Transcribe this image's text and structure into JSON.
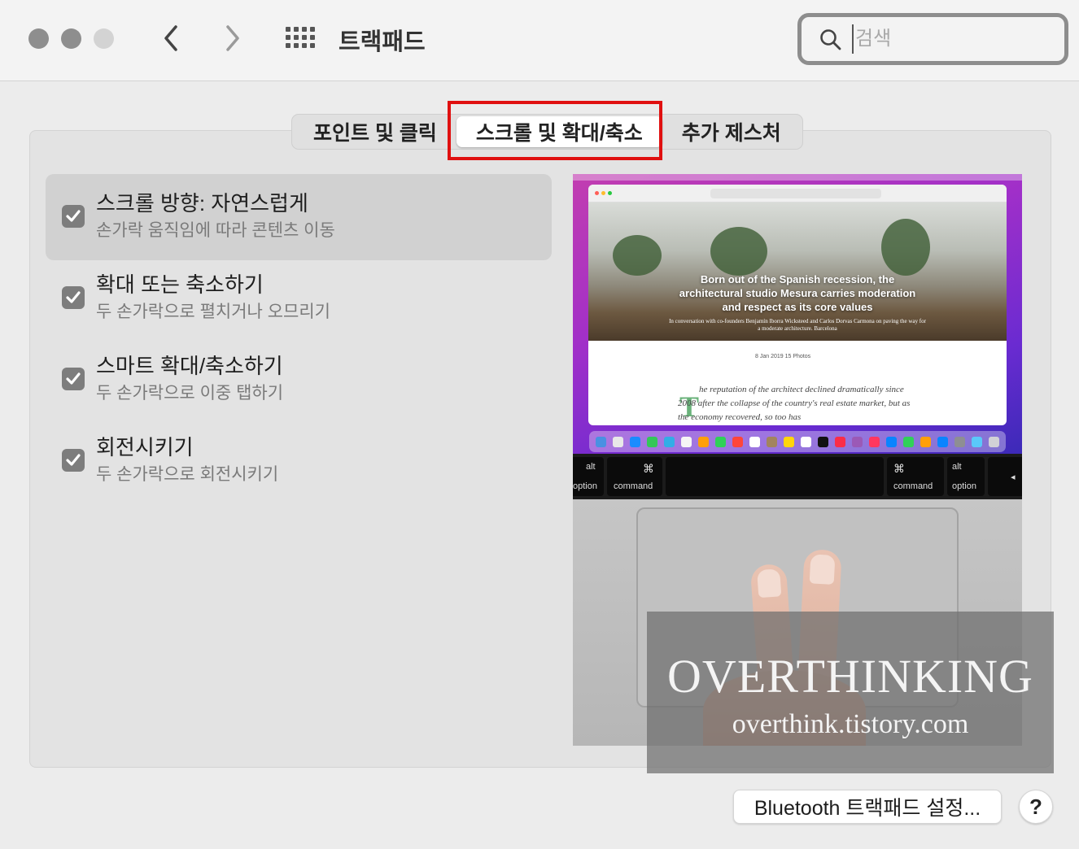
{
  "window": {
    "title": "트랙패드",
    "search": {
      "placeholder": "검색",
      "value": ""
    }
  },
  "tabs": [
    {
      "label": "포인트 및 클릭",
      "selected": false
    },
    {
      "label": "스크롤 및 확대/축소",
      "selected": true
    },
    {
      "label": "추가 제스처",
      "selected": false
    }
  ],
  "options": [
    {
      "title": "스크롤 방향: 자연스럽게",
      "subtitle": "손가락 움직임에 따라 콘텐츠 이동",
      "checked": true,
      "highlighted": true
    },
    {
      "title": "확대 또는 축소하기",
      "subtitle": "두 손가락으로 펼치거나 오므리기",
      "checked": true,
      "highlighted": false
    },
    {
      "title": "스마트 확대/축소하기",
      "subtitle": "두 손가락으로 이중 탭하기",
      "checked": true,
      "highlighted": false
    },
    {
      "title": "회전시키기",
      "subtitle": "두 손가락으로 회전시키기",
      "checked": true,
      "highlighted": false
    }
  ],
  "preview": {
    "headline": [
      "Born out of the Spanish recession, the",
      "architectural studio Mesura carries moderation",
      "and respect as its core values"
    ],
    "caption": [
      "In conversation with co-founders Benjamín Iborra Wicksteed and Carlos Dorvas Carmona on paving the way for",
      "a moderate architecture. Barcelona"
    ],
    "meta": "8 Jan 2019     15 Photos",
    "drop_cap": "T",
    "body": "he reputation of the architect declined dramatically since 2008 after the collapse of the country's real estate market, but as the economy recovered, so too has",
    "keys": {
      "left_alt": "alt",
      "left_option": "option",
      "left_cmd_symbol": "⌘",
      "left_command": "command",
      "right_cmd_symbol": "⌘",
      "right_command": "command",
      "right_alt": "alt",
      "right_option": "option"
    }
  },
  "watermark": {
    "title": "OVERTHINKING",
    "url": "overthink.tistory.com"
  },
  "buttons": {
    "bluetooth": "Bluetooth 트랙패드 설정...",
    "help": "?"
  },
  "colors": {
    "highlight_box": "#e01010",
    "checkbox": "#7d7d7d",
    "active_row": "#d1d1d1"
  }
}
